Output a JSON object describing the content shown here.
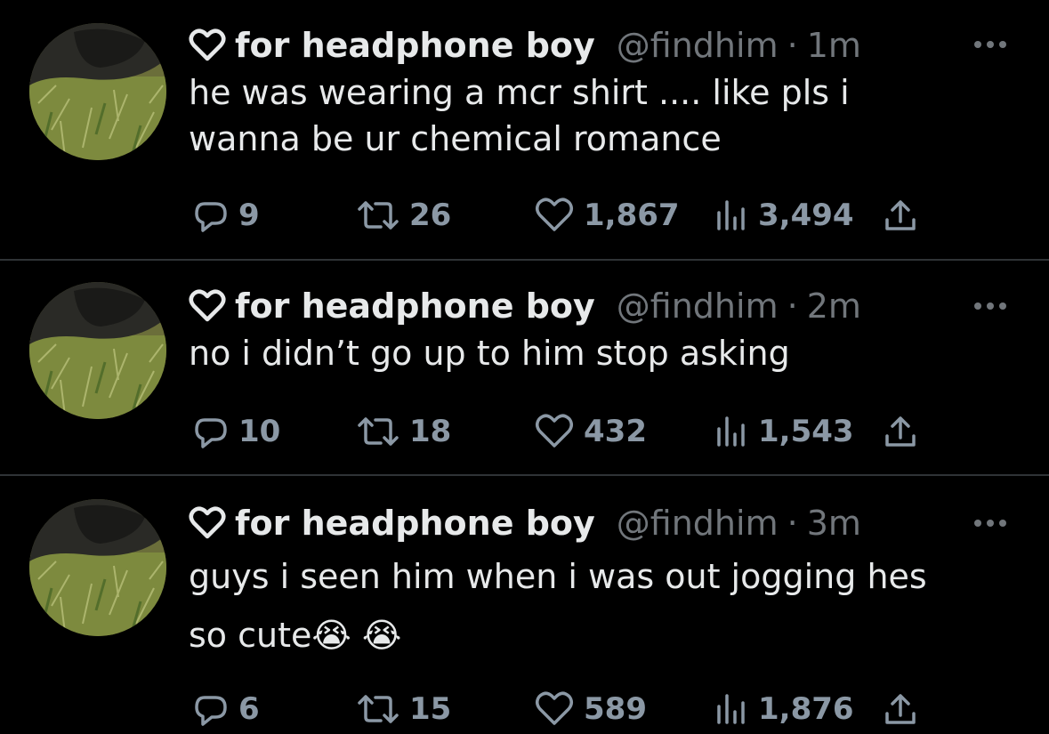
{
  "tweets": [
    {
      "display_name": "for headphone boy",
      "handle": "@findhim",
      "separator": "·",
      "time": "1m",
      "text": "he was wearing a mcr shirt .... like pls i\nwanna be ur chemical romance",
      "replies": "9",
      "retweets": "26",
      "likes": "1,867",
      "views": "3,494"
    },
    {
      "display_name": "for headphone boy",
      "handle": "@findhim",
      "separator": "·",
      "time": "2m",
      "text": "no i didn’t go up to him stop asking",
      "replies": "10",
      "retweets": "18",
      "likes": "432",
      "views": "1,543"
    },
    {
      "display_name": "for headphone boy",
      "handle": "@findhim",
      "separator": "·",
      "time": "3m",
      "text": "guys i seen him when i was out jogging hes\nso cute😭 😭",
      "replies": "6",
      "retweets": "15",
      "likes": "589",
      "views": "1,876"
    }
  ],
  "icons": {
    "badge": "heart-outline-icon",
    "more": "more-dots-icon",
    "reply": "reply-icon",
    "retweet": "retweet-icon",
    "like": "like-heart-icon",
    "views": "views-bar-chart-icon",
    "share": "share-icon"
  },
  "colors": {
    "background": "#000000",
    "primary_text": "#e7e9ea",
    "secondary_text": "#71767b",
    "action_gray": "#8b98a5",
    "divider": "#2f3336"
  }
}
